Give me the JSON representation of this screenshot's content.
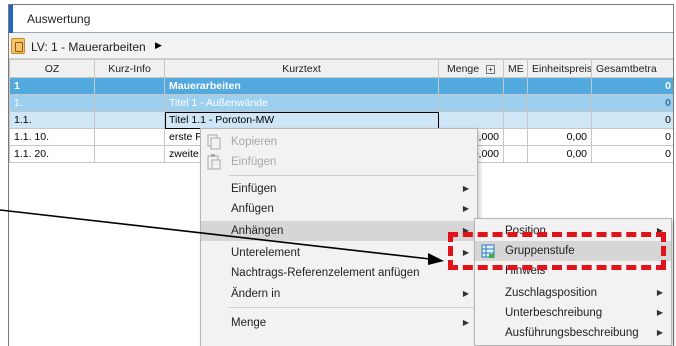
{
  "window": {
    "title": "Auswertung"
  },
  "breadcrumb": {
    "label": "LV: 1 - Mauerarbeiten",
    "arrow": "▶"
  },
  "table": {
    "columns": [
      "OZ",
      "Kurz-Info",
      "Kurztext",
      "Menge",
      "ME",
      "Einheitspreis",
      "Gesamtbetra"
    ],
    "rows": [
      {
        "oz": "1",
        "kurzinfo": "",
        "kurztext": "Mauerarbeiten",
        "menge": "",
        "me": "",
        "ep": "",
        "gb": "0"
      },
      {
        "oz": "1.",
        "kurzinfo": "",
        "kurztext": "Titel 1 - Außenwände",
        "menge": "",
        "me": "",
        "ep": "",
        "gb": "0"
      },
      {
        "oz": "1.1.",
        "kurzinfo": "",
        "kurztext": "Titel 1.1 - Poroton-MW",
        "menge": "",
        "me": "",
        "ep": "",
        "gb": "0"
      },
      {
        "oz": "1.1. 10.",
        "kurzinfo": "",
        "kurztext": "erste P",
        "menge": "0,000",
        "me": "",
        "ep": "0,00",
        "gb": "0"
      },
      {
        "oz": "1.1. 20.",
        "kurzinfo": "",
        "kurztext": "zweite",
        "menge": "0,000",
        "me": "",
        "ep": "0,00",
        "gb": "0"
      }
    ]
  },
  "context_menu": {
    "copy": "Kopieren",
    "paste": "Einfügen",
    "insert": "Einfügen",
    "append": "Anfügen",
    "attach": "Anhängen",
    "subelement": "Unterelement",
    "nachtrag": "Nachtrags-Referenzelement anfügen",
    "change_in": "Ändern in",
    "quantity": "Menge"
  },
  "submenu": {
    "position": "Position",
    "gruppenstufe": "Gruppenstufe",
    "hinweis": "Hinweis",
    "zuschlag": "Zuschlagsposition",
    "unterbeschreibung": "Unterbeschreibung",
    "ausfuehrung": "Ausführungsbeschreibung"
  },
  "colors": {
    "highlight_box": "#e0121a",
    "row_main": "#51a9dd",
    "row_sub": "#9dd0ef",
    "row_selected": "#cfe6f7"
  }
}
